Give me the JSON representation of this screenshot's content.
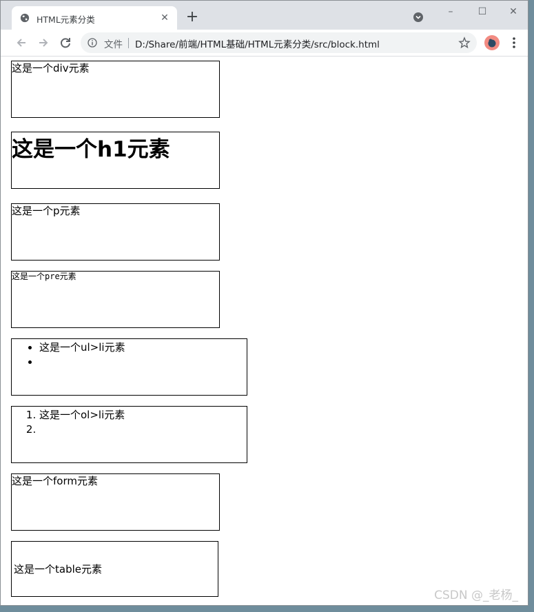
{
  "browser": {
    "tab_title": "HTML元素分类",
    "security_label": "文件",
    "url": "D:/Share/前端/HTML基础/HTML元素分类/src/block.html"
  },
  "page": {
    "div_text": "这是一个div元素",
    "h1_text": "这是一个h1元素",
    "p_text": "这是一个p元素",
    "pre_text": "这是一个pre元素",
    "ul_items": [
      "这是一个ul>li元素",
      ""
    ],
    "ol_items": [
      "这是一个ol>li元素",
      ""
    ],
    "form_text": "这是一个form元素",
    "table_cell": "这是一个table元素"
  },
  "watermark": "CSDN @_老杨_",
  "colors": {
    "tabstrip": "#dee1e6",
    "omnibox": "#f1f3f4",
    "avatar": "#f28b82"
  }
}
